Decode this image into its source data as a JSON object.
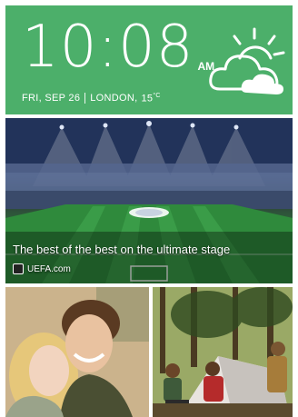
{
  "clock": {
    "time": "10:08",
    "ampm": "AM",
    "date": "FRI, SEP 26",
    "location": "LONDON,",
    "temp_value": "15",
    "temp_unit": "°C"
  },
  "weather": {
    "icon": "partly-cloudy-icon"
  },
  "news": {
    "title": "The best of the best on the ultimate stage",
    "source": "UEFA.com"
  },
  "photos": [
    {
      "name": "photo-couple-selfie"
    },
    {
      "name": "photo-camping-tent"
    }
  ],
  "colors": {
    "widget_green": "#4caf6a"
  }
}
